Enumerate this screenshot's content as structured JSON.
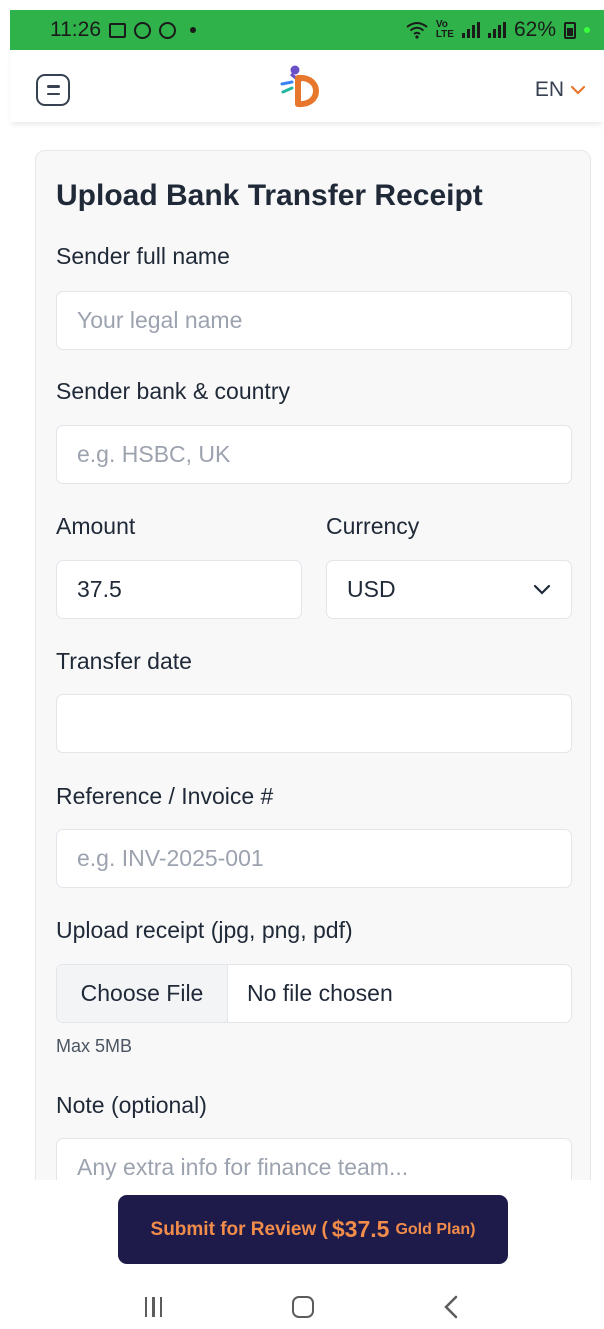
{
  "status_bar": {
    "time": "11:26",
    "battery_text": "62%"
  },
  "header": {
    "language": "EN"
  },
  "form": {
    "title": "Upload Bank Transfer Receipt",
    "sender_name": {
      "label": "Sender full name",
      "placeholder": "Your legal name"
    },
    "sender_bank": {
      "label": "Sender bank & country",
      "placeholder": "e.g. HSBC, UK"
    },
    "amount": {
      "label": "Amount",
      "value": "37.5"
    },
    "currency": {
      "label": "Currency",
      "value": "USD"
    },
    "transfer_date": {
      "label": "Transfer date",
      "value": ""
    },
    "reference": {
      "label": "Reference / Invoice #",
      "placeholder": "e.g. INV-2025-001"
    },
    "upload": {
      "label": "Upload receipt (jpg, png, pdf)",
      "button": "Choose File",
      "file_status": "No file chosen",
      "hint": "Max 5MB"
    },
    "note": {
      "label": "Note (optional)",
      "placeholder": "Any extra info for finance team..."
    }
  },
  "submit": {
    "prefix": "Submit for Review (",
    "amount": "$37.5",
    "plan": "Gold Plan)"
  },
  "colors": {
    "status_bar_bg": "#2fb24a",
    "submit_bg": "#1e1b4b",
    "submit_text": "#f28c4a",
    "accent": "#e8772e"
  }
}
